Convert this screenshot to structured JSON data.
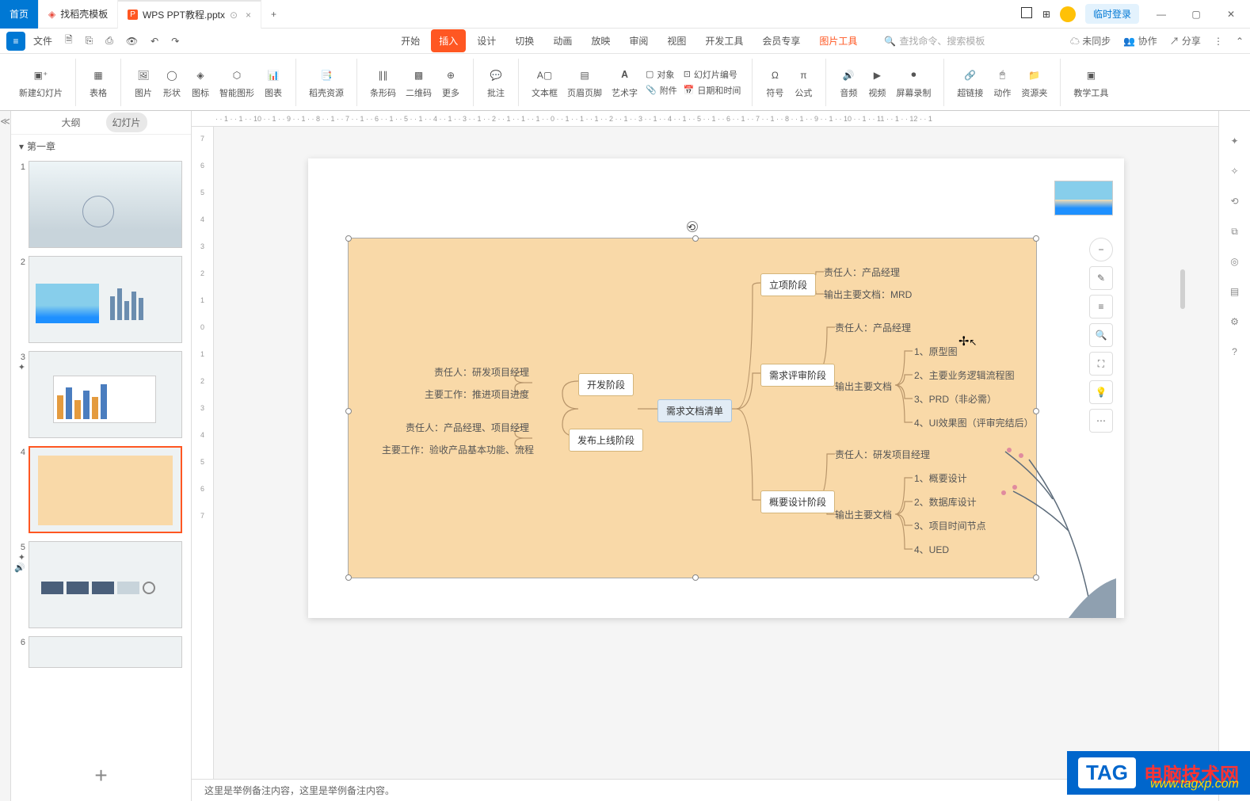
{
  "tabs": {
    "home": "首页",
    "docer": "找稻壳模板",
    "file": "WPS PPT教程.pptx"
  },
  "titlebar": {
    "login": "临时登录"
  },
  "menubar": {
    "file": "文件",
    "tabs": [
      "开始",
      "插入",
      "设计",
      "切换",
      "动画",
      "放映",
      "审阅",
      "视图",
      "开发工具",
      "会员专享",
      "图片工具"
    ],
    "active": 1,
    "highlight": 10,
    "search_ph": "查找命令、搜索模板",
    "unsync": "未同步",
    "collab": "协作",
    "share": "分享"
  },
  "ribbon": {
    "new_slide": "新建幻灯片",
    "table": "表格",
    "picture": "图片",
    "shape": "形状",
    "icon": "图标",
    "smart": "智能图形",
    "chart": "图表",
    "docer_res": "稻壳资源",
    "barcode": "条形码",
    "qr": "二维码",
    "more": "更多",
    "comment": "批注",
    "textbox": "文本框",
    "header": "页眉页脚",
    "wordart": "艺术字",
    "object": "对象",
    "attach": "附件",
    "slidenum": "幻灯片编号",
    "datetime": "日期和时间",
    "symbol": "符号",
    "equation": "公式",
    "audio": "音频",
    "video": "视频",
    "screenrec": "屏幕录制",
    "hyperlink": "超链接",
    "action": "动作",
    "resource": "资源夹",
    "teaching": "教学工具"
  },
  "panel": {
    "outline": "大纲",
    "slides": "幻灯片",
    "chapter": "第一章"
  },
  "mindmap": {
    "root": "需求文档清单",
    "dev": "开发阶段",
    "dev_l1": "责任人：研发项目经理",
    "dev_l2": "主要工作：推进项目进度",
    "release": "发布上线阶段",
    "rel_l1": "责任人：产品经理、项目经理",
    "rel_l2": "主要工作：验收产品基本功能、流程",
    "init": "立项阶段",
    "init_l1": "责任人：产品经理",
    "init_l2": "输出主要文档：MRD",
    "review": "需求评审阶段",
    "rev_l1": "责任人：产品经理",
    "rev_l2": "输出主要文档",
    "rev_d1": "1、原型图",
    "rev_d2": "2、主要业务逻辑流程图",
    "rev_d3": "3、PRD（非必需）",
    "rev_d4": "4、UI效果图（评审完结后）",
    "design": "概要设计阶段",
    "des_l1": "责任人：研发项目经理",
    "des_l2": "输出主要文档",
    "des_d1": "1、概要设计",
    "des_d2": "2、数据库设计",
    "des_d3": "3、项目时间节点",
    "des_d4": "4、UED"
  },
  "notes": "这里是举例备注内容，这里是举例备注内容。",
  "watermark": {
    "tag": "TAG",
    "site": "电脑技术网",
    "url": "www.tagxp.com"
  },
  "ruler": "· · 1 · · 1 · · 10 · · 1 · · 9 · · 1 · · 8 · · 1 · · 7 · · 1 · · 6 · · 1 · · 5 · · 1 · · 4 · · 1 · · 3 · · 1 · · 2 · · 1 · · 1 · · 1 · · 0 · · 1 · · 1 · · 1 · · 2 · · 1 · · 3 · · 1 · · 4 · · 1 · · 5 · · 1 · · 6 · · 1 · · 7 · · 1 · · 8 · · 1 · · 9 · · 1 · · 10 · · 1 · · 11 · · 1 · · 12 · · 1"
}
